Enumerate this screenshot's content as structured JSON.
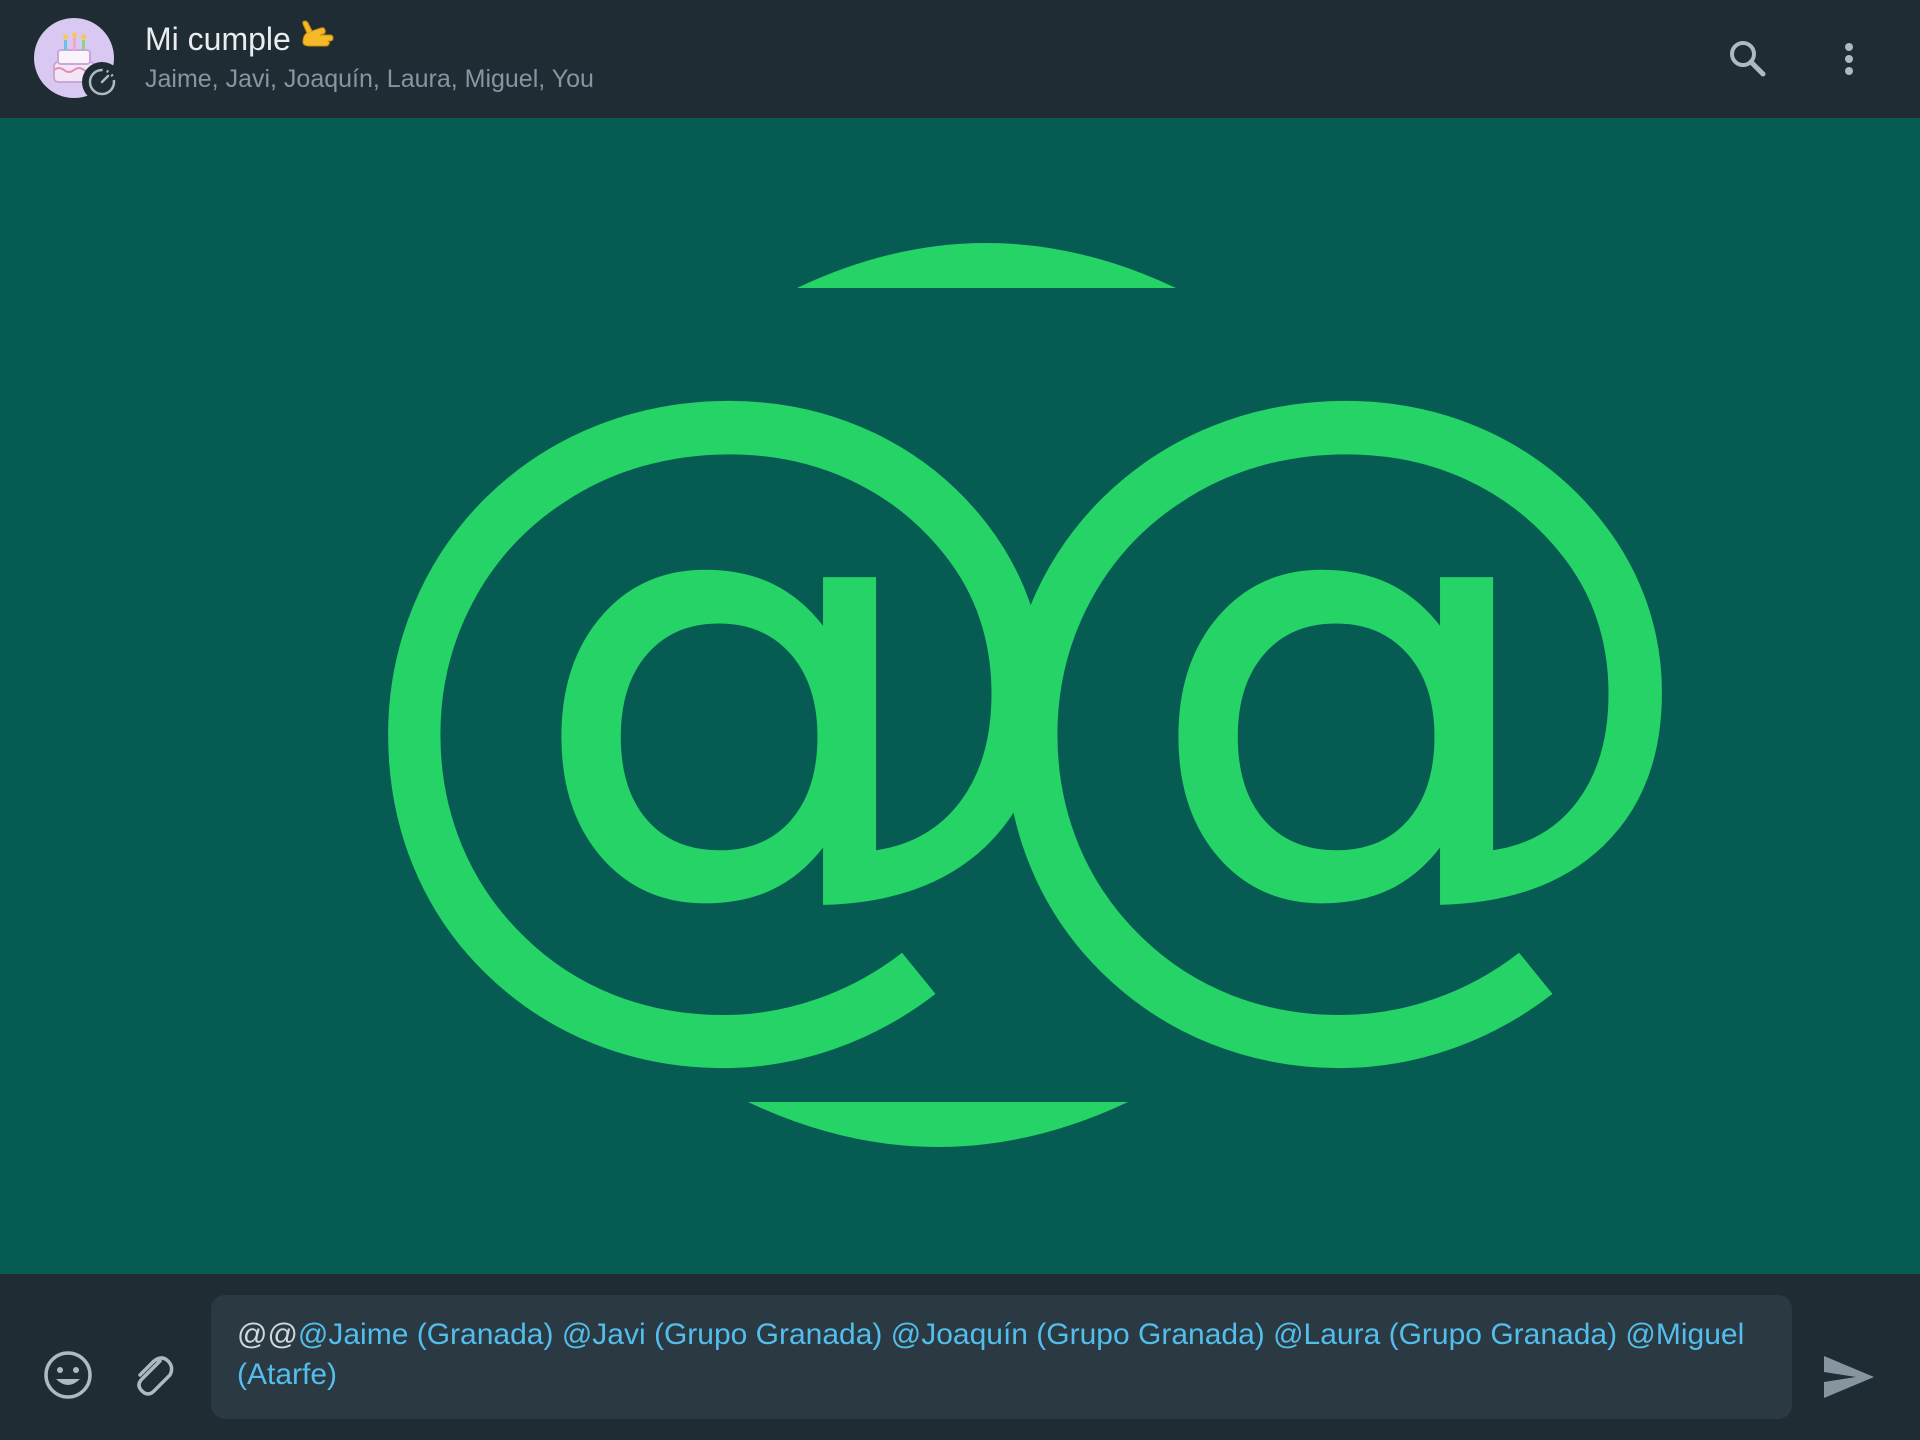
{
  "header": {
    "title": "Mi cumple",
    "participants": "Jaime, Javi, Joaquín, Laura, Miguel, You",
    "avatar_icon": "birthday-cake-icon",
    "avatar_badge_icon": "disappearing-timer-icon",
    "title_emoji_icon": "call-me-hand-emoji",
    "search_icon": "search-icon",
    "menu_icon": "more-vertical-icon"
  },
  "hero": {
    "illustration": "double-at-sign-mention-icon",
    "accent_color": "#25d366",
    "background_color": "#065c53"
  },
  "composer": {
    "typed_prefix": "@@",
    "mentions": [
      "@Jaime (Granada)",
      "@Javi (Grupo Granada)",
      "@Joaquín (Grupo Granada)",
      "@Laura (Grupo Granada)",
      "@Miguel (Atarfe)"
    ],
    "emoji_icon": "emoji-icon",
    "attach_icon": "paperclip-icon",
    "send_icon": "send-icon"
  },
  "colors": {
    "header_bg": "#202c33",
    "composer_bg": "#2a3942",
    "mention_text": "#53bdeb",
    "primary_text": "#e9edef",
    "secondary_text": "#8696a0"
  }
}
